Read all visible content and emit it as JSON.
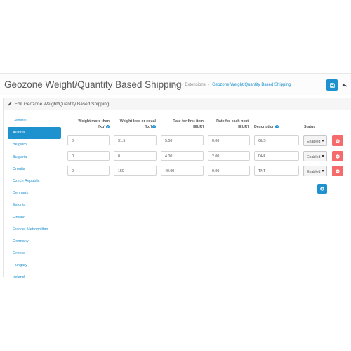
{
  "header": {
    "title": "Geozone Weight/Quantity Based Shipping",
    "breadcrumb": [
      "Home",
      "Extensions",
      "Geozone Weight/Quantity Based Shipping"
    ]
  },
  "panel": {
    "heading": "Edit Geozone Weight/Quantity Based Shipping"
  },
  "geozones": [
    {
      "label": "General",
      "active": false
    },
    {
      "label": "Austria",
      "active": true
    },
    {
      "label": "Belgium",
      "active": false
    },
    {
      "label": "Bulgaria",
      "active": false
    },
    {
      "label": "Croatia",
      "active": false
    },
    {
      "label": "Czech Republic",
      "active": false
    },
    {
      "label": "Denmark",
      "active": false
    },
    {
      "label": "Estonia",
      "active": false
    },
    {
      "label": "Finland",
      "active": false
    },
    {
      "label": "France, Metropolitan",
      "active": false
    },
    {
      "label": "Germany",
      "active": false
    },
    {
      "label": "Greece",
      "active": false
    },
    {
      "label": "Hungary",
      "active": false
    },
    {
      "label": "Ireland",
      "active": false
    }
  ],
  "table": {
    "headers": {
      "weight_more_line1": "Weight more than",
      "weight_more_line2": "[kg]",
      "weight_less_line1": "Weight less or equal",
      "weight_less_line2": "[kg]",
      "rate_first_line1": "Rate for first item",
      "rate_first_line2": "[EUR]",
      "rate_next_line1": "Rate for each next",
      "rate_next_line2": "[EUR]",
      "description": "Description",
      "status": "Status"
    },
    "rows": [
      {
        "weight_more": "0",
        "weight_less": "31.5",
        "rate_first": "5.00",
        "rate_next": "0.00",
        "description": "GLS",
        "status": "Enabled"
      },
      {
        "weight_more": "0",
        "weight_less": "0",
        "rate_first": "4.00",
        "rate_next": "2.00",
        "description": "DHL",
        "status": "Enabled"
      },
      {
        "weight_more": "0",
        "weight_less": "150",
        "rate_first": "40.00",
        "rate_next": "0.00",
        "description": "TNT",
        "status": "Enabled"
      }
    ]
  },
  "icons": {
    "save": "save-icon",
    "back": "reply-icon",
    "edit": "pencil-icon",
    "help": "question-circle-icon",
    "remove": "minus-circle-icon",
    "add": "plus-circle-icon"
  },
  "colors": {
    "primary": "#1e91cf",
    "danger": "#f56b6b"
  }
}
